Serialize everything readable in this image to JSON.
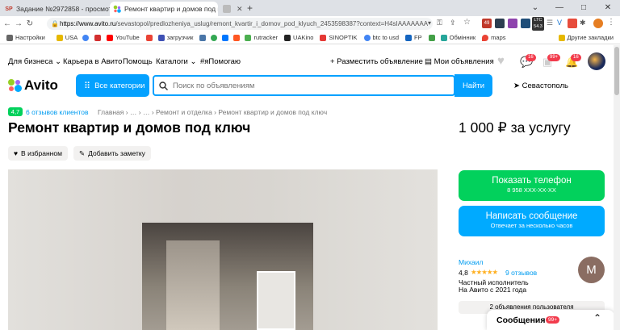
{
  "browser": {
    "tabs": [
      {
        "title": "Задание №2972858 - просмотр з",
        "favicon": "SP"
      },
      {
        "title": "Ремонт квартир и домов под кл"
      },
      {
        "title": ""
      }
    ],
    "url_host": "https://www.avito.ru",
    "url_path": "/sevastopol/predlozheniya_uslug/remont_kvartir_i_domov_pod_klyuch_2453598387?context=H4sIAAAAAAA",
    "extensions": {
      "e1": "49",
      "e2": "LTC",
      "e3": "54.3"
    },
    "bookmarks": [
      "Настройки",
      "USA",
      "YouTube",
      "загрузчик",
      "rutracker",
      "UAKino",
      "SINOPTIK",
      "btc to usd",
      "FP",
      "Обмінник",
      "maps",
      "Другие закладки"
    ]
  },
  "header": {
    "business": "Для бизнеса",
    "career": "Карьера в Авито",
    "help": "Помощь",
    "catalogs": "Каталоги",
    "tag": "#яПомогаю",
    "post_ad": "+ Разместить объявление",
    "my_ads": "Мои объявления",
    "badge_msg": "16",
    "badge_cart": "99+",
    "badge_notif": "16"
  },
  "search": {
    "logo": "Avito",
    "categories": "Все категории",
    "placeholder": "Поиск по объявлениям",
    "button": "Найти",
    "location": "Севастополь"
  },
  "listing": {
    "rating": "4,7",
    "reviews_link": "6 отзывов клиентов",
    "breadcrumb": "Главная › … › … › Ремонт и отделка › Ремонт квартир и домов под ключ",
    "title": "Ремонт квартир и домов под ключ",
    "price": "1 000 ₽ за услугу",
    "favorite": "В избранном",
    "add_note": "Добавить заметку"
  },
  "seller": {
    "show_phone": "Показать телефон",
    "phone_masked": "8 958 XXX-XX-XX",
    "write": "Написать сообщение",
    "reply_time": "Отвечает за несколько часов",
    "name": "Михаил",
    "rating": "4,8",
    "stars": "★★★★★",
    "reviews": "9 отзывов",
    "type": "Частный исполнитель",
    "since": "На Авито с 2021 года",
    "avatar_letter": "M",
    "user_ads": "2 объявления пользователя"
  },
  "messages": {
    "label": "Сообщения",
    "count": "99+"
  },
  "colors": {
    "blue": "#04a1ff",
    "green": "#02d15c",
    "chip_green": "#02d15c",
    "red": "#f23b4c"
  }
}
